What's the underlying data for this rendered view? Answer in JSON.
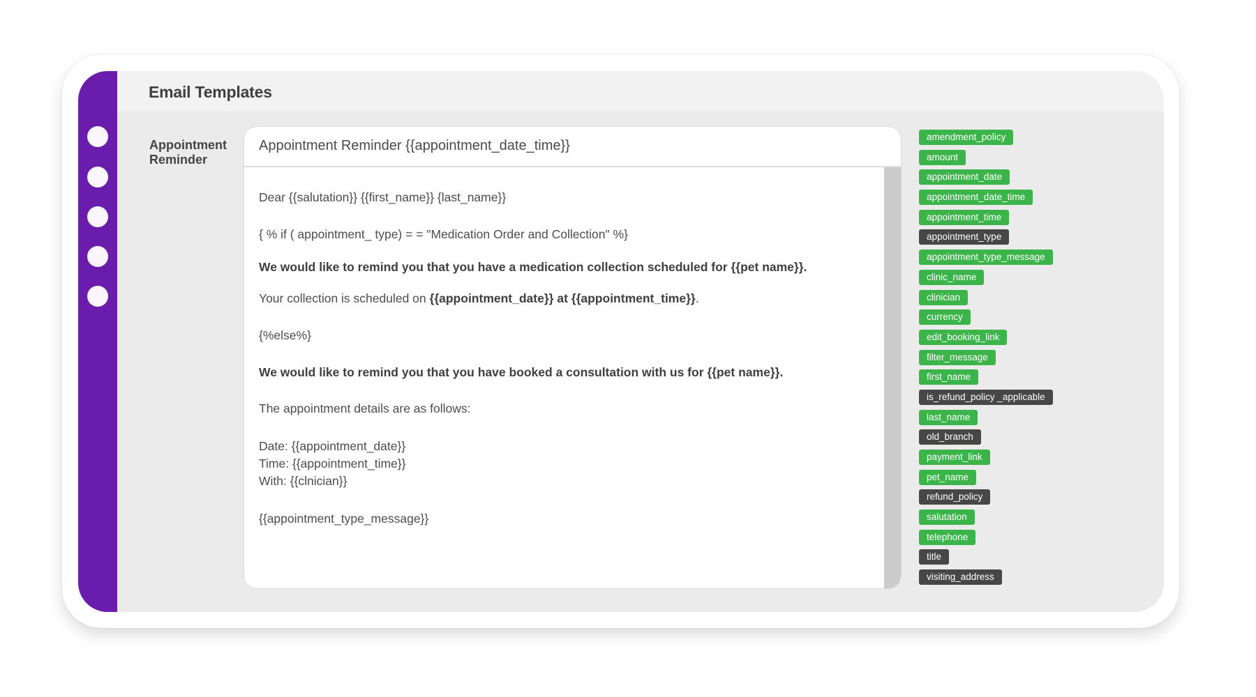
{
  "colors": {
    "sidebar": "#6a1dab",
    "tag_available": "#3bb54a",
    "tag_unavailable": "#474747"
  },
  "sidebar": {
    "items": [
      {
        "icon": "nav-dot-icon"
      },
      {
        "icon": "nav-dot-icon"
      },
      {
        "icon": "nav-dot-icon"
      },
      {
        "icon": "nav-dot-icon"
      },
      {
        "icon": "nav-dot-icon"
      }
    ]
  },
  "header": {
    "title": "Email Templates"
  },
  "template": {
    "label_line1": "Appointment",
    "label_line2": "Reminder",
    "subject": "Appointment Reminder {{appointment_date_time}}",
    "body": {
      "greeting": "Dear {{salutation}} {{first_name}} {last_name}}",
      "if_clause": "{ % if ( appointment_ type) = = \"Medication Order and Collection\" %}",
      "medication_reminder": "We would like to remind you that you have a medication collection scheduled for {{pet name}}.",
      "collection_prefix": "Your collection is scheduled on ",
      "collection_date": "{{appointment_date}}",
      "collection_at": " at ",
      "collection_time": "{{appointment_time}}",
      "collection_suffix": ".",
      "else_clause": "{%else%}",
      "consultation_reminder": "We would like to remind you that you have booked a consultation with us for {{pet name}}.",
      "details_intro": "The appointment details are as follows:",
      "date_line": "Date: {{appointment_date}}",
      "time_line": "Time: {{appointment_time}}",
      "with_line": "With: {{clnician}}",
      "type_message": "{{appointment_type_message}}"
    }
  },
  "placeholders": [
    {
      "name": "amendment_policy",
      "state": "green"
    },
    {
      "name": "amount",
      "state": "green"
    },
    {
      "name": "appointment_date",
      "state": "green"
    },
    {
      "name": "appointment_date_time",
      "state": "green"
    },
    {
      "name": "appointment_time",
      "state": "green"
    },
    {
      "name": "appointment_type",
      "state": "dark"
    },
    {
      "name": "appointment_type_message",
      "state": "green"
    },
    {
      "name": "clinic_name",
      "state": "green"
    },
    {
      "name": "clinician",
      "state": "green"
    },
    {
      "name": "currency",
      "state": "green"
    },
    {
      "name": "edit_booking_link",
      "state": "green"
    },
    {
      "name": "filter_message",
      "state": "green"
    },
    {
      "name": "first_name",
      "state": "green"
    },
    {
      "name": "is_refund_policy _applicable",
      "state": "dark"
    },
    {
      "name": "last_name",
      "state": "green"
    },
    {
      "name": "old_branch",
      "state": "dark"
    },
    {
      "name": "payment_link",
      "state": "green"
    },
    {
      "name": "pet_name",
      "state": "green"
    },
    {
      "name": "refund_policy",
      "state": "dark"
    },
    {
      "name": "salutation",
      "state": "green"
    },
    {
      "name": "telephone",
      "state": "green"
    },
    {
      "name": "title",
      "state": "dark"
    },
    {
      "name": "visiting_address",
      "state": "dark"
    }
  ]
}
